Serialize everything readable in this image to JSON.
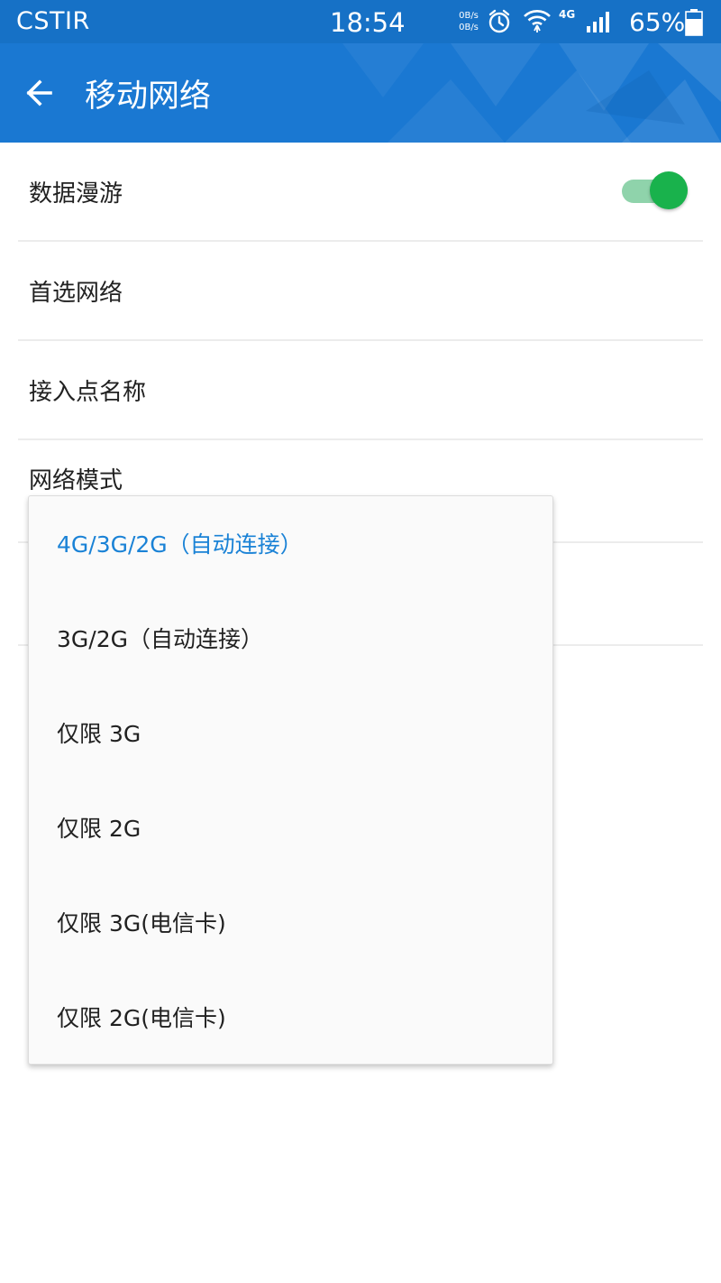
{
  "status_bar": {
    "carrier": "CSTIR",
    "time": "18:54",
    "upload_speed": "0B/s",
    "download_speed": "0B/s",
    "network_type": "4G",
    "battery_percent": "65%",
    "icons": [
      "alarm-icon",
      "wifi-icon",
      "signal-icon",
      "battery-icon"
    ]
  },
  "app_bar": {
    "title": "移动网络",
    "back_icon": "back-arrow-icon"
  },
  "settings": [
    {
      "label": "数据漫游",
      "toggle_on": true
    },
    {
      "label": "首选网络"
    },
    {
      "label": "接入点名称"
    },
    {
      "label": "网络模式"
    }
  ],
  "network_mode_dropdown": {
    "options": [
      {
        "label": "4G/3G/2G（自动连接）",
        "selected": true
      },
      {
        "label": "3G/2G（自动连接）"
      },
      {
        "label": "仅限 3G"
      },
      {
        "label": "仅限 2G"
      },
      {
        "label": "仅限 3G(电信卡)"
      },
      {
        "label": "仅限 2G(电信卡)"
      }
    ]
  },
  "colors": {
    "status_bar": "#1671c6",
    "app_bar": "#1a78d2",
    "accent": "#1a82d6",
    "toggle_thumb": "#19b24c",
    "toggle_track": "#8fd3ab"
  }
}
